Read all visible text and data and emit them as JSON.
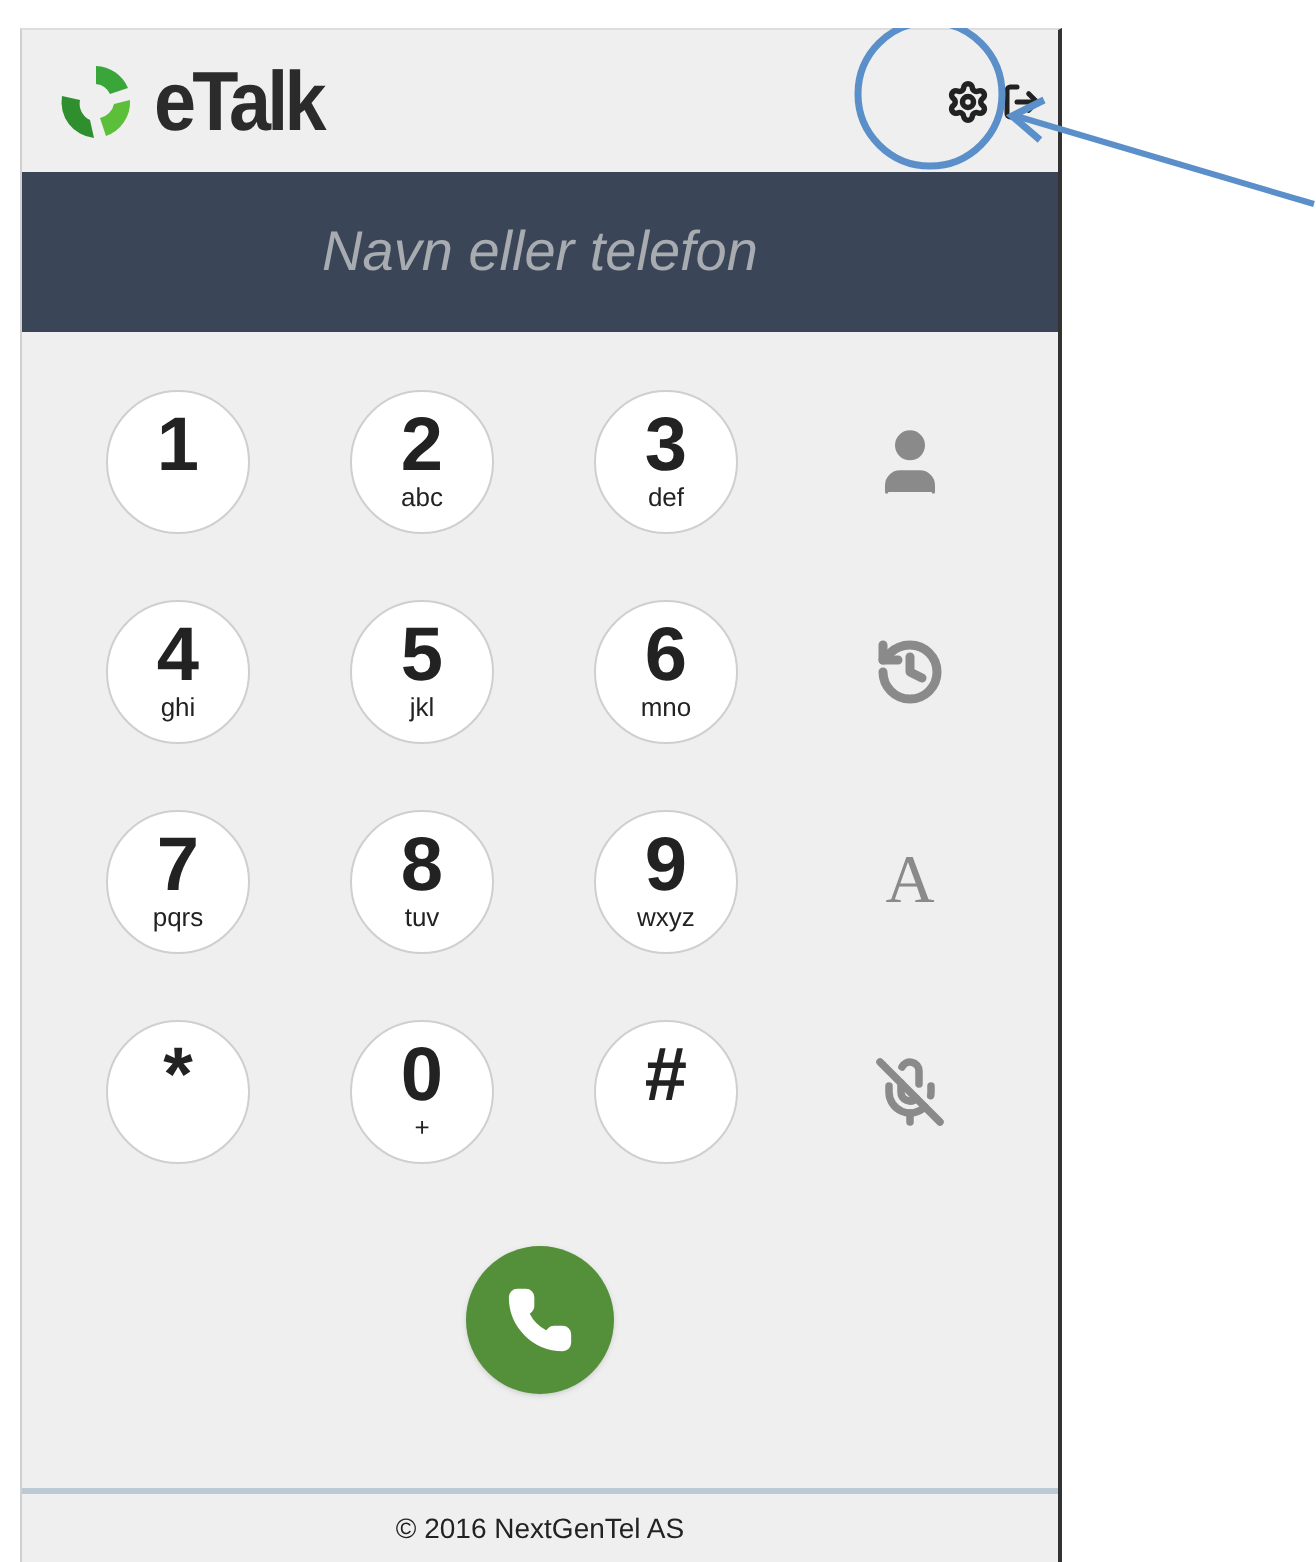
{
  "header": {
    "logo_text": "eTalk"
  },
  "search": {
    "placeholder": "Navn eller telefon"
  },
  "keys": [
    {
      "digit": "1"
    },
    {
      "digit": "2",
      "letters": "abc"
    },
    {
      "digit": "3",
      "letters": "def"
    },
    {
      "kind": "contacts"
    },
    {
      "digit": "4",
      "letters": "ghi"
    },
    {
      "digit": "5",
      "letters": "jkl"
    },
    {
      "digit": "6",
      "letters": "mno"
    },
    {
      "kind": "history"
    },
    {
      "digit": "7",
      "letters": "pqrs"
    },
    {
      "digit": "8",
      "letters": "tuv"
    },
    {
      "digit": "9",
      "letters": "wxyz"
    },
    {
      "kind": "font",
      "label": "A"
    },
    {
      "digit": "*"
    },
    {
      "digit": "0",
      "letters": "+"
    },
    {
      "digit": "#"
    },
    {
      "kind": "mute"
    }
  ],
  "footer": {
    "text": "© 2016 NextGenTel AS"
  }
}
